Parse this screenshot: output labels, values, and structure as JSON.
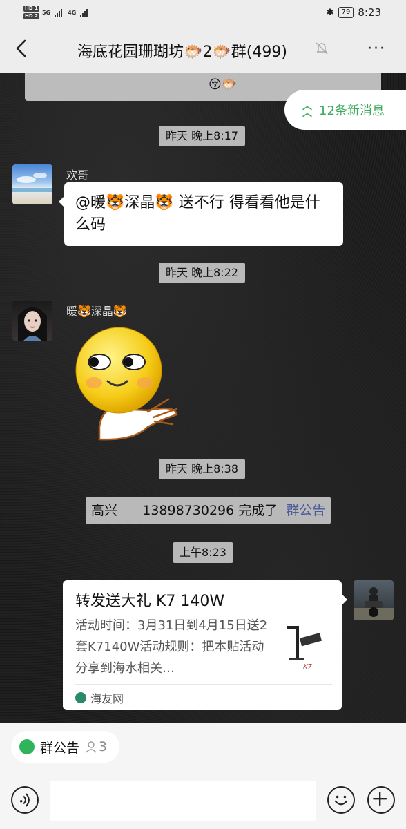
{
  "status": {
    "net_badges": [
      "HD 1",
      "HD 2"
    ],
    "net_types": [
      "5G",
      "4G"
    ],
    "battery": "79",
    "time": "8:23"
  },
  "header": {
    "title": "海底花园珊瑚坊🐡2🐡群(499)",
    "more": "···"
  },
  "chat": {
    "prev_emoji": "😚🐡",
    "new_messages": "12条新消息",
    "messages": [
      {
        "time": "昨天 晚上8:17",
        "sender": "欢哥",
        "text": "@暖🐯深晶🐯  送不行 得看看他是什么码"
      },
      {
        "time": "昨天 晚上8:22",
        "sender": "暖🐯深晶🐯"
      },
      {
        "time": "昨天 晚上8:38",
        "system": "高兴      13898730296 完成了",
        "system_link": "群公告"
      },
      {
        "time": "上午8:23",
        "card": {
          "title": "转发送大礼 K7 140W",
          "desc": "活动时间：3月31日到4月15日送2套K7140W活动规则：把本贴活动分享到海水相关…",
          "thumb_label": "K7",
          "source": "海友网"
        }
      }
    ]
  },
  "bottom": {
    "chip_label": "群公告",
    "chip_count": "3"
  },
  "colors": {
    "accent_green": "#3eaa5e",
    "link_blue": "#4a5b9a",
    "bar_bg": "#ededed"
  }
}
